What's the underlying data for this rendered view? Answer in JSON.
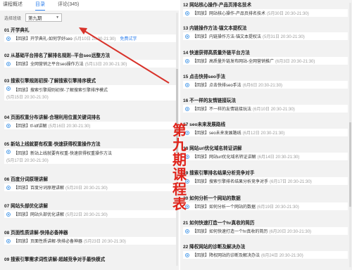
{
  "tabs": [
    {
      "label": "课程概述"
    },
    {
      "label": "目录"
    },
    {
      "label": "评论(345)"
    }
  ],
  "filter": {
    "label": "选择班级",
    "value": "第九期"
  },
  "left_items": [
    {
      "title": "01 开学典礼",
      "text": "【回放】开学典礼-如何学好seo",
      "time": "(5月10日 20:30-21:30)",
      "trial": "免费试学"
    },
    {
      "title": "02 从基础平台排名了解排名规则--平台seo远整方法",
      "text": "【回放】全网营销之平台seo操作方法",
      "time": "(5月13日 20:30-21:30)"
    },
    {
      "title": "03 搜索引擎规则初探-了解搜索引擎排序模式",
      "text": "【回放】搜索引擎规则初探-了解搜索引擎排序模式",
      "time": "(5月15日 20:30-21:30)"
    },
    {
      "title": "04 页面权重分布讲解-合理利用位置关键词排名",
      "text": "【回放】tf-idf讲解",
      "time": "(5月16日 20:30-21:30)"
    },
    {
      "title": "05 新站上线就要有权重-快速获得权重操作方法",
      "text": "【回放】新站上线就要有权重-快速获得权重操作方法",
      "time": "(5月17日 20:30-21:30)"
    },
    {
      "title": "06 百度分词原理讲解",
      "text": "【回放】百度分词原理讲解",
      "time": "(5月20日 20:30-21:30)"
    },
    {
      "title": "07 网站头部优化讲解",
      "text": "【回放】网站头部优化讲解",
      "time": "(5月22日 20:30-21:30)"
    },
    {
      "title": "08 页面性质讲解-快排必备神器",
      "text": "【回放】页面性质讲解-快排必备神器",
      "time": "(5月23日 20:30-21:30)"
    },
    {
      "title": "09 搜索引擎需求词性讲解-超越竞争对手最快模式",
      "text": "",
      "time": ""
    }
  ],
  "right_items": [
    {
      "title": "12 网站核心操作-产品页排名技术",
      "text": "【回放】网站核心操作-产品页排名技术",
      "time": "(5月30日 20:30-21:30)"
    },
    {
      "title": "13 内链操作方法-锚文本提权法",
      "text": "【回放】内链操作方法-锚文本提权法",
      "time": "(5月31日 20:30-21:30)"
    },
    {
      "title": "14 快速获得高质量外链平台方法",
      "text": "【回放】高质量外链发布网站-全网营销推广",
      "time": "(6月3日 20:30-21:30)"
    },
    {
      "title": "15 点击快排seo手法",
      "text": "【回放】点击快排seo手法",
      "time": "(6月6日 20:30-21:30)"
    },
    {
      "title": "16 不一样的友情链接玩法",
      "text": "【回放】不一样的友情链接玩法",
      "time": "(6月10日 20:30-21:30)"
    },
    {
      "title": "17 seo未来发展路线",
      "text": "【回放】seo未来发展路线",
      "time": "(6月12日 20:30-21:30)"
    },
    {
      "title": "18 网站url优化域名转证讲解",
      "text": "【回放】网站url优化域名转证讲解",
      "time": "(6月14日 20:30-21:30)"
    },
    {
      "title": "19 搜索引擎排名结果分析竞争对手",
      "text": "【回放】搜索引擎排名结果分析竞争对手",
      "time": "(6月17日 20:30-21:30)"
    },
    {
      "title": "20 如何分析一个网站的数据",
      "text": "【回放】如何分析一个网站的数据",
      "time": "(6月19日 20:30-21:30)"
    },
    {
      "title": "21 如何快速打造一个hr真收的简历",
      "text": "【回放】如何快速打造一个hr真收的简历",
      "time": "(6月20日 20:30-21:30)"
    },
    {
      "title": "22 降权网站的诊断及解决办法",
      "text": "【回放】降权网站的诊断及解决办法",
      "time": "(6月24日 20:30-21:30)"
    }
  ],
  "overlay": [
    "第",
    "九",
    "期",
    "课",
    "程",
    "表"
  ],
  "colors": {
    "accent": "#2f80ed",
    "overlay": "#e0241b",
    "arrow": "#d8322a"
  }
}
